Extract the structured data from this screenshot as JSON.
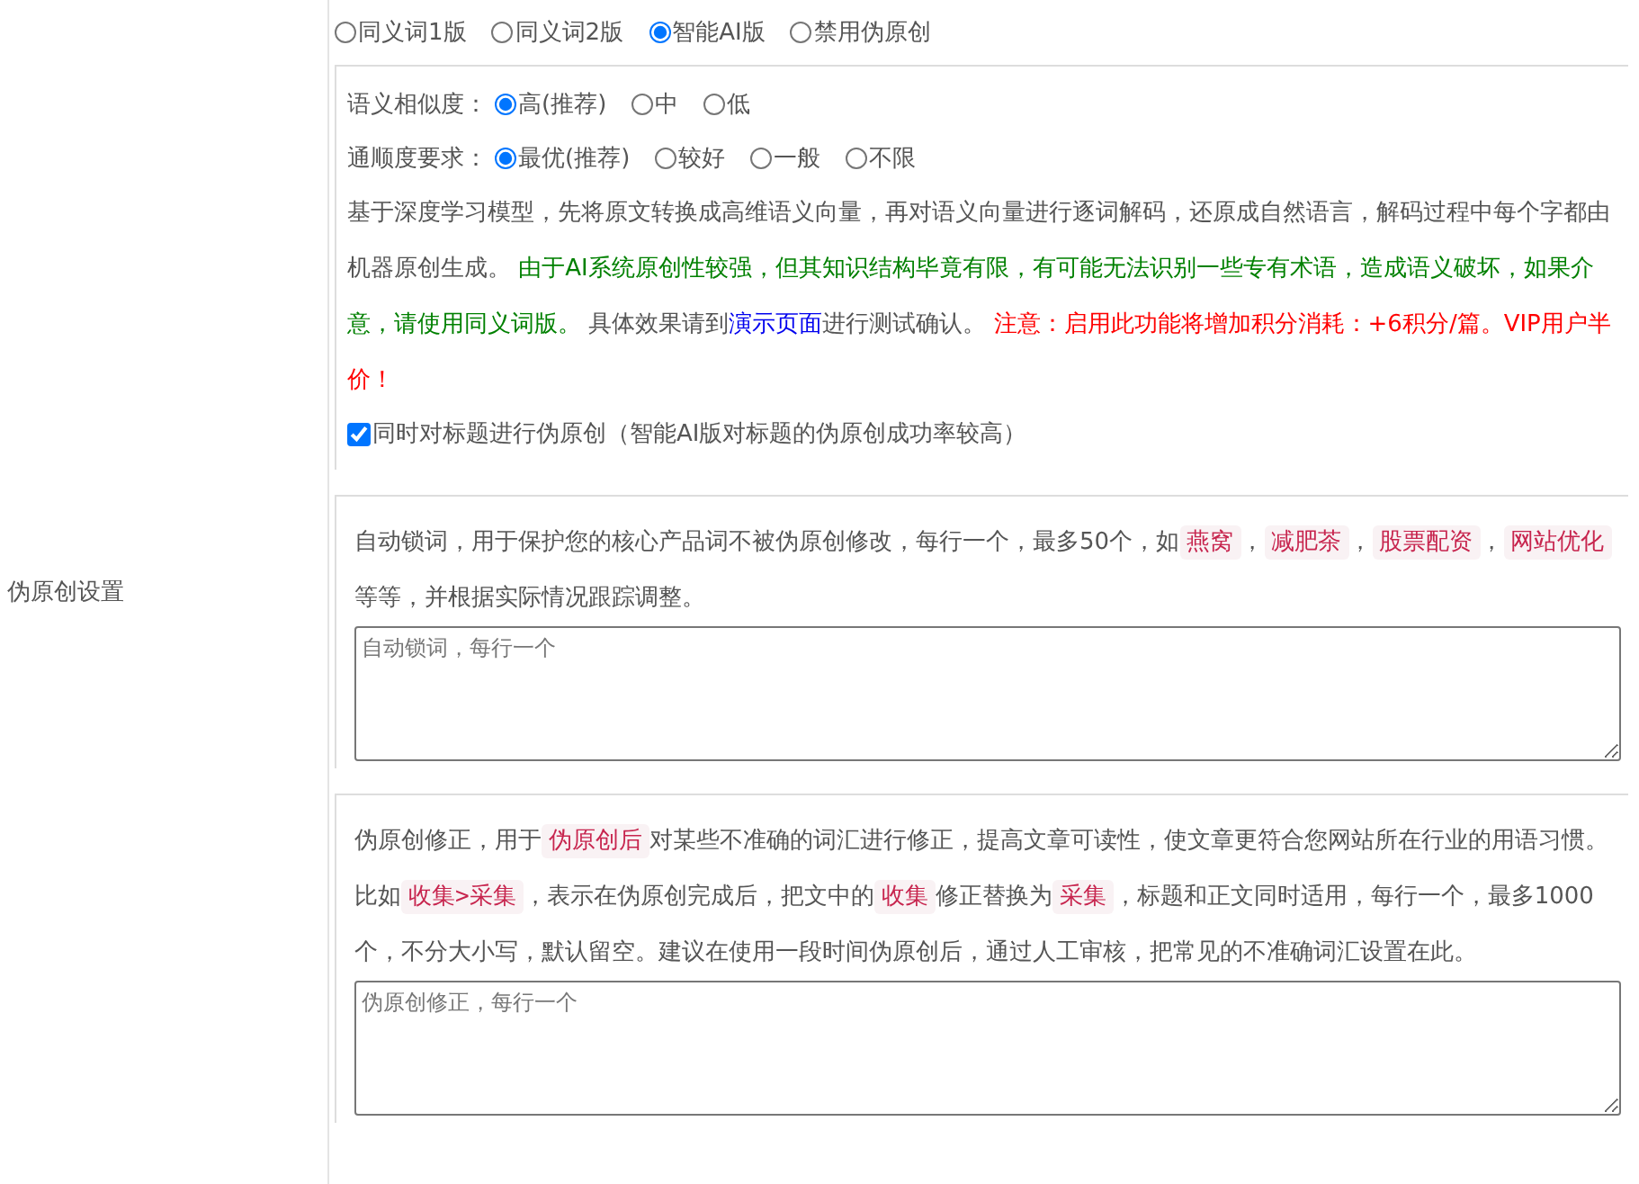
{
  "side_label": "伪原创设置",
  "modes": [
    {
      "label": "同义词1版",
      "selected": false
    },
    {
      "label": "同义词2版",
      "selected": false
    },
    {
      "label": "智能AI版",
      "selected": true
    },
    {
      "label": "禁用伪原创",
      "selected": false
    }
  ],
  "ai_settings": {
    "groups": [
      {
        "label": "语义相似度：",
        "options": [
          {
            "label": "高(推荐)",
            "selected": true
          },
          {
            "label": "中",
            "selected": false
          },
          {
            "label": "低",
            "selected": false
          }
        ]
      },
      {
        "label": "通顺度要求：",
        "options": [
          {
            "label": "最优(推荐)",
            "selected": true
          },
          {
            "label": "较好",
            "selected": false
          },
          {
            "label": "一般",
            "selected": false
          },
          {
            "label": "不限",
            "selected": false
          }
        ]
      }
    ],
    "description": [
      {
        "kind": "plain",
        "text": "基于深度学习模型，先将原文转换成高维语义向量，再对语义向量进行逐词解码，还原成自然语言，解码过程中每个字都由机器原创生成。 "
      },
      {
        "kind": "green",
        "text": "由于AI系统原创性较强，但其知识结构毕竟有限，有可能无法识别一些专有术语，造成语义破坏，如果介意，请使用同义词版。"
      },
      {
        "kind": "plain",
        "text": " 具体效果请到"
      },
      {
        "kind": "link",
        "text": "演示页面"
      },
      {
        "kind": "plain",
        "text": "进行测试确认。 "
      },
      {
        "kind": "red",
        "text": "注意：启用此功能将增加积分消耗：+6积分/篇。VIP用户半价！"
      }
    ],
    "title_option": {
      "label": "同时对标题进行伪原创（智能AI版对标题的伪原创成功率较高）",
      "checked": true
    }
  },
  "lock_words": {
    "description": [
      {
        "kind": "plain",
        "text": "自动锁词，用于保护您的核心产品词不被伪原创修改，每行一个，最多50个，如"
      },
      {
        "kind": "tag",
        "text": "燕窝"
      },
      {
        "kind": "plain",
        "text": "，"
      },
      {
        "kind": "tag",
        "text": "减肥茶"
      },
      {
        "kind": "plain",
        "text": "，"
      },
      {
        "kind": "tag",
        "text": "股票配资"
      },
      {
        "kind": "plain",
        "text": "，"
      },
      {
        "kind": "tag",
        "text": "网站优化"
      },
      {
        "kind": "plain",
        "text": " 等等，并根据实际情况跟踪调整。"
      }
    ],
    "placeholder": "自动锁词，每行一个"
  },
  "correction": {
    "description": [
      {
        "kind": "plain",
        "text": "伪原创修正，用于"
      },
      {
        "kind": "tag",
        "text": "伪原创后"
      },
      {
        "kind": "plain",
        "text": "对某些不准确的词汇进行修正，提高文章可读性，使文章更符合您网站所在行业的用语习惯。比如"
      },
      {
        "kind": "tag",
        "text": "收集>采集"
      },
      {
        "kind": "plain",
        "text": "，表示在伪原创完成后，把文中的"
      },
      {
        "kind": "tag",
        "text": "收集"
      },
      {
        "kind": "plain",
        "text": "修正替换为"
      },
      {
        "kind": "tag",
        "text": "采集"
      },
      {
        "kind": "plain",
        "text": "，标题和正文同时适用，每行一个，最多1000个，不分大小写，默认留空。建议在使用一段时间伪原创后，通过人工审核，把常见的不准确词汇设置在此。"
      }
    ],
    "placeholder": "伪原创修正，每行一个"
  }
}
